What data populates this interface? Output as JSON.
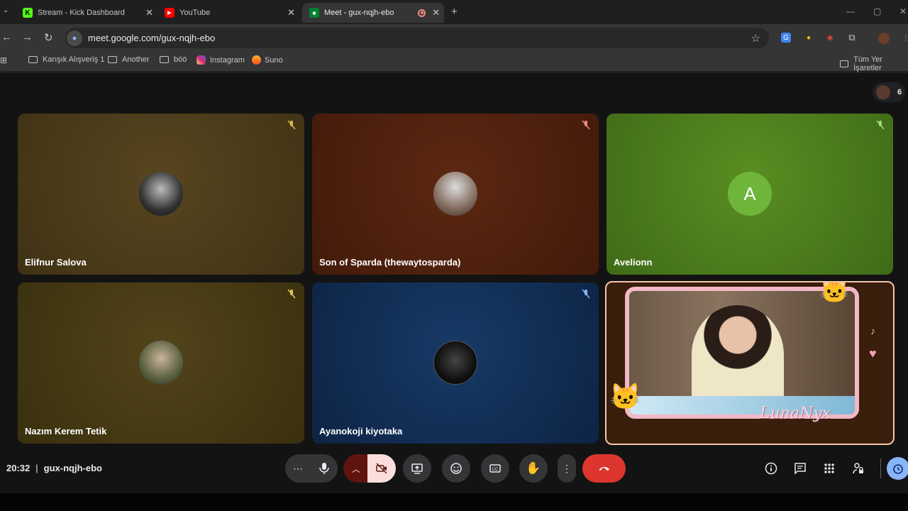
{
  "tabs": [
    {
      "title": "Stream - Kick Dashboard",
      "favicon": "kick-icon"
    },
    {
      "title": "YouTube",
      "favicon": "youtube-icon"
    },
    {
      "title": "Meet - gux-nqjh-ebo",
      "favicon": "meet-icon"
    }
  ],
  "address": {
    "url": "meet.google.com/gux-nqjh-ebo"
  },
  "bookmarks": {
    "items": [
      "Karışık Alışveriş 1",
      "Another",
      "böö",
      "Instagram",
      "Suno"
    ],
    "all_bookmarks": "Tüm Yer İşaretler"
  },
  "participants_count": "6",
  "tiles": [
    {
      "name": "Elifnur Salova",
      "bg": "#4a3a17",
      "muted": true
    },
    {
      "name": "Son of Sparda (thewaytosparda)",
      "bg": "#4e1f0d",
      "muted": true
    },
    {
      "name": "Avelionn",
      "bg": "#4d7a1c",
      "muted": true,
      "initial": "A"
    },
    {
      "name": "Nazım Kerem Tetik",
      "bg": "#45390f",
      "muted": true
    },
    {
      "name": "Ayanokoji kiyotaka",
      "bg": "#0f2a4c",
      "muted": true
    }
  ],
  "self_tile": {
    "overlay_text": "LunaNyx"
  },
  "meeting": {
    "time": "20:32",
    "separator": "|",
    "code": "gux-nqjh-ebo"
  },
  "colors": {
    "leave": "#dc362e",
    "active_cam": "#f9dedc",
    "present_up": "#601410"
  }
}
